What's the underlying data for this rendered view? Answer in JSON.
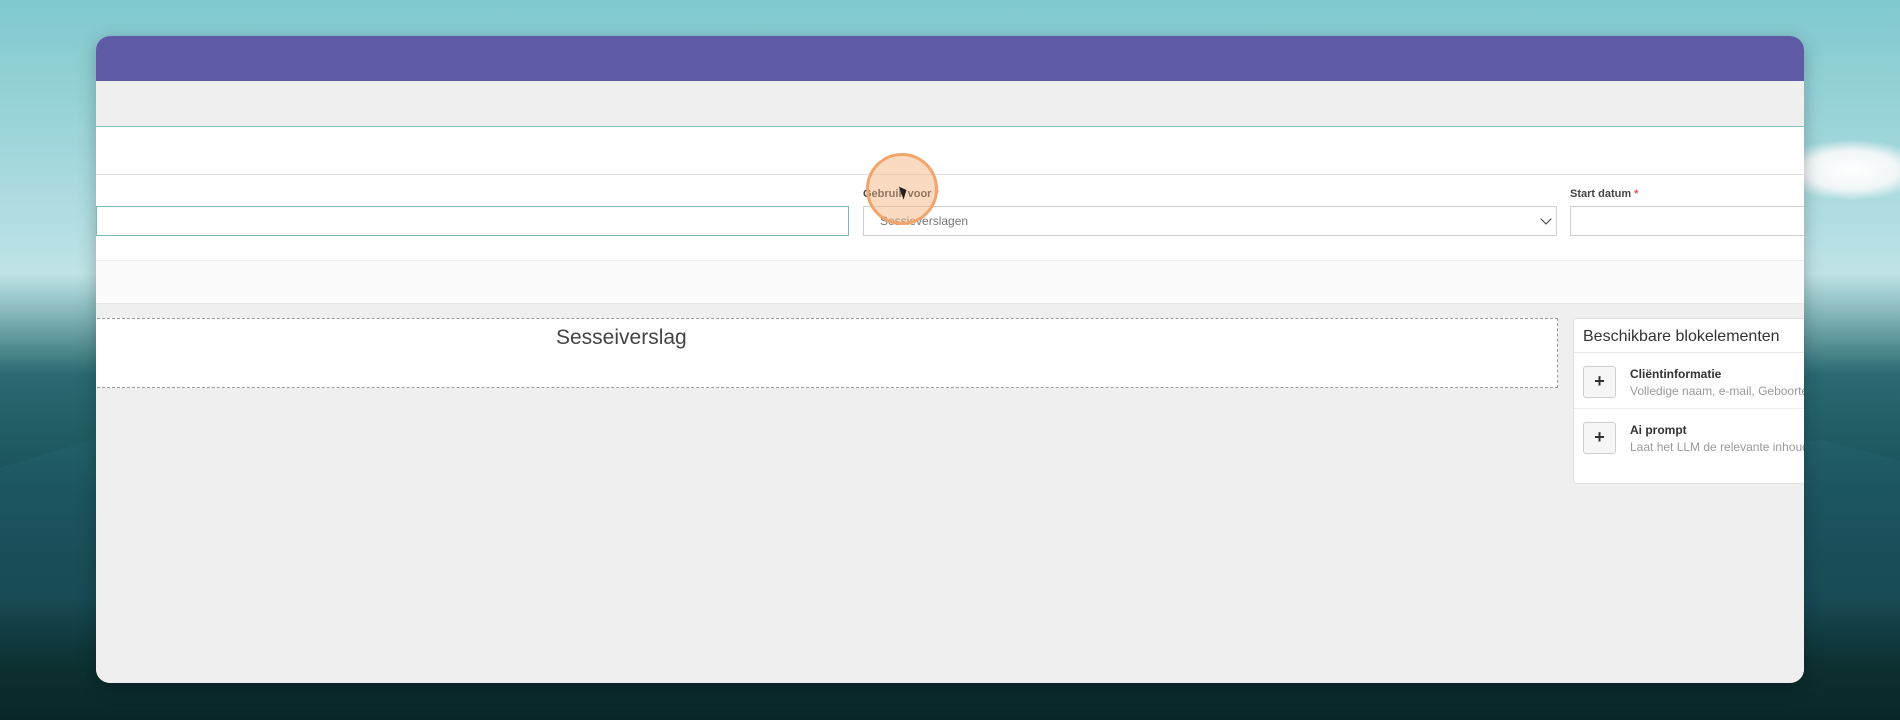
{
  "form": {
    "used_for": {
      "label": "Gebruik voor",
      "required_mark": "*",
      "selected": "Sessieverslagen"
    },
    "start_date": {
      "label": "Start datum",
      "required_mark": "*",
      "value": ""
    },
    "name": {
      "value": ""
    }
  },
  "canvas": {
    "section_title": "Sesseiverslag"
  },
  "palette": {
    "title": "Beschikbare blokelementen",
    "items": [
      {
        "title": "Cliëntinformatie",
        "description": "Volledige naam, e-mail, Geboortedatum"
      },
      {
        "title": "Ai prompt",
        "description": "Laat het LLM de relevante inhoud genereren"
      }
    ],
    "add_symbol": "+"
  },
  "colors": {
    "titlebar": "#5f5aa6",
    "accent_border": "#7db8c2",
    "required": "#d9534f"
  }
}
